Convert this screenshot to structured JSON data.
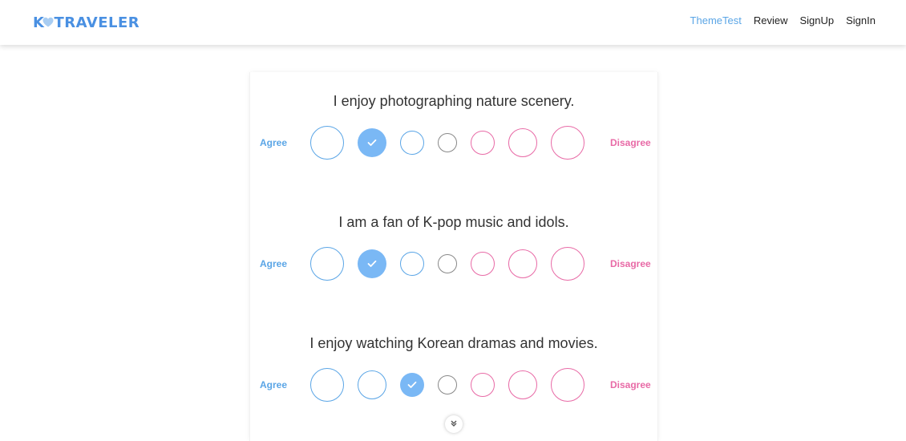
{
  "brand": {
    "prefix": "K",
    "suffix": "TRAVELER",
    "color": "#4a90e2",
    "heart_icon": "heart-icon"
  },
  "nav": {
    "items": [
      {
        "label": "ThemeTest",
        "active": true
      },
      {
        "label": "Review",
        "active": false
      },
      {
        "label": "SignUp",
        "active": false
      },
      {
        "label": "SignIn",
        "active": false
      }
    ]
  },
  "colors": {
    "agree": "#5aa5e6",
    "neutral": "#888888",
    "disagree": "#e86aa6",
    "selected": "#7ab8f5"
  },
  "scale": {
    "agree_label": "Agree",
    "disagree_label": "Disagree",
    "option_count": 7,
    "neutral_index": 3
  },
  "questions": [
    {
      "text": "I enjoy photographing nature scenery.",
      "selected": 1
    },
    {
      "text": "I am a fan of K-pop music and idols.",
      "selected": 1
    },
    {
      "text": "I enjoy watching Korean dramas and movies.",
      "selected": 2
    }
  ],
  "scroll_icon": "chevron-down-icon"
}
